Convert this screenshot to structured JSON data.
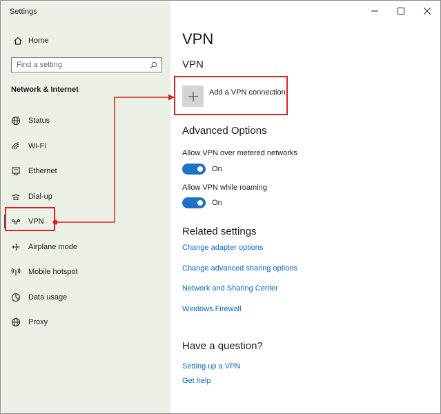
{
  "window": {
    "title": "Settings"
  },
  "controls": {
    "minimize": "—",
    "maximize": "☐",
    "close": "✕"
  },
  "sidebar": {
    "home_label": "Home",
    "search": {
      "placeholder": "Find a setting",
      "value": ""
    },
    "section_title": "Network & Internet",
    "items": [
      {
        "label": "Status",
        "icon": "globe-status-icon"
      },
      {
        "label": "Wi-Fi",
        "icon": "wifi-icon"
      },
      {
        "label": "Ethernet",
        "icon": "ethernet-icon"
      },
      {
        "label": "Dial-up",
        "icon": "dialup-icon"
      },
      {
        "label": "VPN",
        "icon": "vpn-icon",
        "selected": true
      },
      {
        "label": "Airplane mode",
        "icon": "airplane-icon"
      },
      {
        "label": "Mobile hotspot",
        "icon": "hotspot-icon"
      },
      {
        "label": "Data usage",
        "icon": "data-usage-icon"
      },
      {
        "label": "Proxy",
        "icon": "globe-icon"
      }
    ]
  },
  "main": {
    "page_title": "VPN",
    "vpn_heading": "VPN",
    "add_vpn_label": "Add a VPN connection",
    "advanced_heading": "Advanced Options",
    "options": [
      {
        "label": "Allow VPN over metered networks",
        "state": "On"
      },
      {
        "label": "Allow VPN while roaming",
        "state": "On"
      }
    ],
    "related_heading": "Related settings",
    "related_links": [
      "Change adapter options",
      "Change advanced sharing options",
      "Network and Sharing Center",
      "Windows Firewall"
    ],
    "question_heading": "Have a question?",
    "help_links": [
      "Setting up a VPN",
      "Get help"
    ]
  },
  "colors": {
    "sidebar_bg": "#eaf0e6",
    "accent": "#1e73c8",
    "link": "#0a66c2",
    "annotation": "#e02020"
  }
}
